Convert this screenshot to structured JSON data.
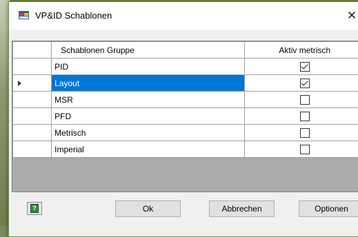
{
  "window": {
    "title": "VP&ID Schablonen",
    "close_glyph": "✕"
  },
  "grid": {
    "columns": [
      "Schablonen Gruppe",
      "Aktiv metrisch"
    ],
    "rows": [
      {
        "name": "PID",
        "active_metric": true
      },
      {
        "name": "Layout",
        "active_metric": true,
        "selected": true
      },
      {
        "name": "MSR",
        "active_metric": false
      },
      {
        "name": "PFD",
        "active_metric": false
      },
      {
        "name": "Metrisch",
        "active_metric": false
      },
      {
        "name": "Imperial",
        "active_metric": false
      }
    ],
    "selected_row_color": "#0078d7"
  },
  "footer": {
    "help_icon": "help-icon",
    "ok_label": "Ok",
    "cancel_label": "Abbrechen",
    "options_label": "Optionen"
  },
  "colors": {
    "window_border": "#6e9a2c",
    "grid_background": "#ababab"
  }
}
